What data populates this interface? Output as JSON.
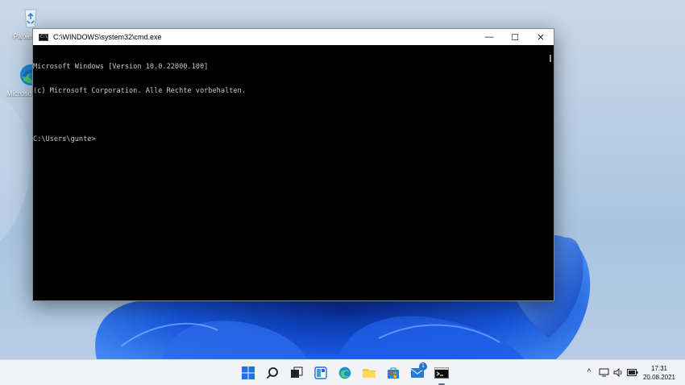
{
  "desktop": {
    "icons": [
      {
        "label": "Papierkorb",
        "icon": "recycle-bin-icon"
      },
      {
        "label": "Microsoft Edge",
        "icon": "edge-icon"
      }
    ]
  },
  "window": {
    "title": "C:\\WINDOWS\\system32\\cmd.exe",
    "controls": {
      "minimize": "—",
      "maximize": "☐",
      "close": "✕"
    },
    "console_lines": [
      "Microsoft Windows [Version 10.0.22000.100]",
      "(c) Microsoft Corporation. Alle Rechte vorbehalten.",
      "",
      "C:\\Users\\gunte>"
    ]
  },
  "taskbar": {
    "apps": [
      {
        "name": "start",
        "icon": "windows-start-icon"
      },
      {
        "name": "search",
        "icon": "search-icon"
      },
      {
        "name": "task-view",
        "icon": "task-view-icon"
      },
      {
        "name": "widgets",
        "icon": "widgets-icon"
      },
      {
        "name": "edge",
        "icon": "edge-icon"
      },
      {
        "name": "explorer",
        "icon": "folder-icon"
      },
      {
        "name": "store",
        "icon": "store-icon"
      },
      {
        "name": "mail",
        "icon": "mail-icon",
        "badge": "1"
      },
      {
        "name": "terminal",
        "icon": "cmd-icon"
      }
    ],
    "tray": {
      "chevron": "^",
      "icons": [
        "network-icon",
        "speaker-icon",
        "battery-icon"
      ]
    },
    "clock": {
      "time": "17:31",
      "date": "20.08.2021"
    }
  },
  "colors": {
    "accent": "#0f5bd6",
    "console_text": "#c8c8c8",
    "console_bg": "#000000"
  }
}
